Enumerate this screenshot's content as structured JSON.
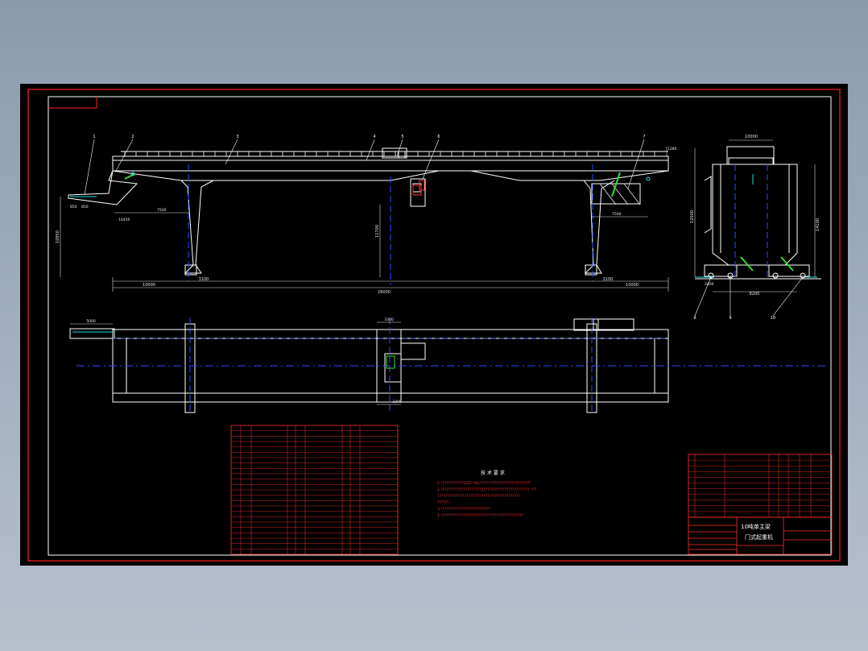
{
  "drawing": {
    "title_block": {
      "name_line1": "10吨单主梁",
      "name_line2": "门式起重机"
    },
    "dimensions": {
      "top_view": {
        "span_total": "26000",
        "left_cantilever": "10000",
        "right_cantilever": "10000",
        "span_right": "3100",
        "height_left": "10950",
        "height_center": "11700",
        "left_arm_a": "850",
        "left_arm_b": "850",
        "left_arm_c": "14450",
        "left_mid": "7500",
        "right_mid": "7500",
        "left_gap": "3100",
        "right_top": "1280"
      },
      "side_view": {
        "top": "10000",
        "height_left": "12000",
        "height_right": "14100",
        "base": "8200",
        "base_left": "2400"
      },
      "plan_view": {
        "left_ext": "5000",
        "trolley_w": "3300",
        "trolley_h": "3300"
      }
    },
    "callouts": {
      "elevation": [
        "1",
        "2",
        "3",
        "4",
        "5",
        "6",
        "7"
      ],
      "side": [
        "8",
        "9",
        "10"
      ]
    },
    "notes": {
      "title": "技 术 要 求",
      "lines": [
        "1.????????????1257-91???????????????????????????",
        "2.?????????????????????5???????????????????????? ???",
        "  ???????????????????????????????????????????",
        "  ??????",
        "3.??????????????????????????",
        "4.???????????????????????????????????????????"
      ]
    },
    "parts_list_rows": 10,
    "bom_table": {
      "rows": [
        [
          "",
          "",
          "",
          "",
          "",
          "",
          ""
        ],
        [
          "",
          "",
          "",
          "",
          "",
          "",
          ""
        ]
      ]
    }
  },
  "colors": {
    "frame": "#ff2020",
    "structure": "#ffffff",
    "centerline": "#2b4bff",
    "accent_green": "#33dd33",
    "accent_cyan": "#22dddd",
    "dimension": "#dddddd",
    "table_red": "#ff3030"
  }
}
